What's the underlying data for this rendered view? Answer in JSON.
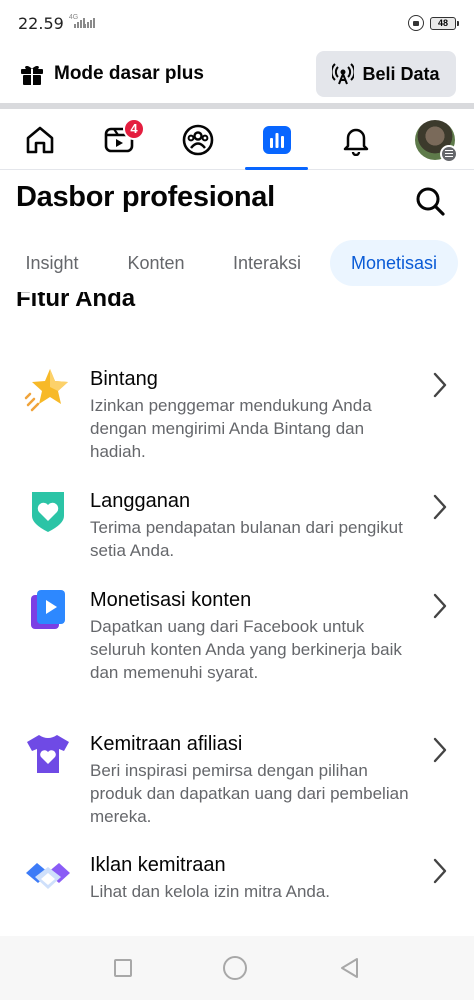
{
  "status_bar": {
    "time": "22.59",
    "network_label": "4G",
    "battery": "48"
  },
  "banner": {
    "mode_label": "Mode dasar plus",
    "buy_data_label": "Beli Data"
  },
  "nav": {
    "items": [
      {
        "name": "home-icon"
      },
      {
        "name": "video-icon",
        "badge": "4"
      },
      {
        "name": "groups-icon"
      },
      {
        "name": "dashboard-icon",
        "active": true
      },
      {
        "name": "bell-icon"
      },
      {
        "name": "profile-avatar"
      }
    ],
    "accent_color": "#0866ff",
    "badge_color": "#e41e3f"
  },
  "header": {
    "title": "Dasbor profesional"
  },
  "tabs": [
    {
      "label": "Insight"
    },
    {
      "label": "Konten"
    },
    {
      "label": "Interaksi"
    },
    {
      "label": "Monetisasi",
      "active": true
    }
  ],
  "section": {
    "heading": "Fitur Anda"
  },
  "features": [
    {
      "icon": "star-icon",
      "title": "Bintang",
      "description": "Izinkan penggemar mendukung Anda dengan mengirimi Anda Bintang dan hadiah."
    },
    {
      "icon": "subscription-heart-icon",
      "title": "Langganan",
      "description": "Terima pendapatan bulanan dari pengikut setia Anda."
    },
    {
      "icon": "video-play-icon",
      "title": "Monetisasi konten",
      "description": "Dapatkan uang dari Facebook untuk seluruh konten Anda yang berkinerja baik dan memenuhi syarat."
    },
    {
      "icon": "shirt-heart-icon",
      "title": "Kemitraan afiliasi",
      "description": "Beri inspirasi pemirsa dengan pilihan produk dan dapatkan uang dari pembelian mereka."
    },
    {
      "icon": "handshake-icon",
      "title": "Iklan kemitraan",
      "description": "Lihat dan kelola izin mitra Anda."
    }
  ]
}
